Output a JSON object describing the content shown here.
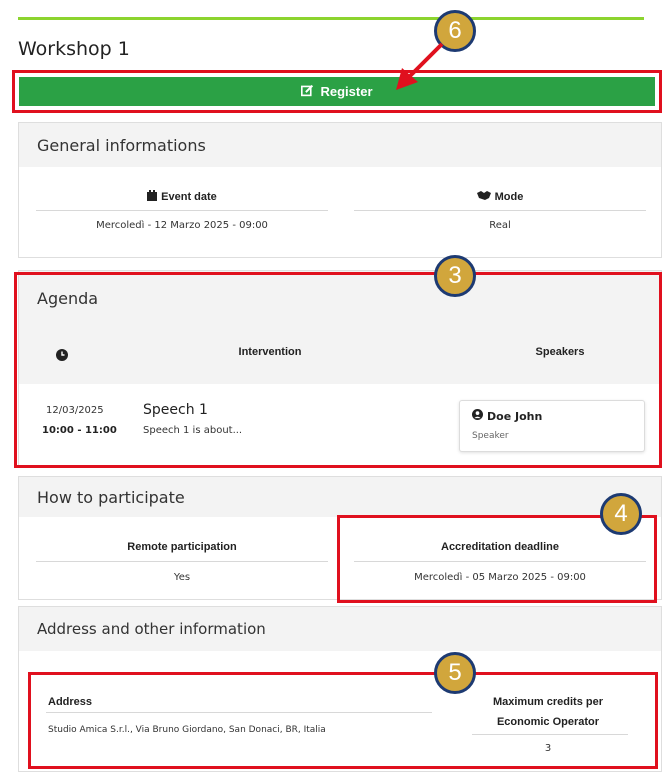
{
  "page_title": "Workshop 1",
  "register_label": "Register",
  "general": {
    "heading": "General informations",
    "event_date_label": "Event date",
    "event_date_value": "Mercoledì - 12 Marzo 2025 - 09:00",
    "mode_label": "Mode",
    "mode_value": "Real"
  },
  "agenda": {
    "heading": "Agenda",
    "col_intervention": "Intervention",
    "col_speakers": "Speakers",
    "rows": [
      {
        "date": "12/03/2025",
        "time": "10:00 - 11:00",
        "title": "Speech 1",
        "description": "Speech 1 is about...",
        "speaker_name": "Doe John",
        "speaker_role": "Speaker"
      }
    ]
  },
  "participate": {
    "heading": "How to participate",
    "remote_label": "Remote participation",
    "remote_value": "Yes",
    "deadline_label": "Accreditation deadline",
    "deadline_value": "Mercoledì - 05 Marzo 2025 - 09:00"
  },
  "address": {
    "heading": "Address and other information",
    "address_label": "Address",
    "address_value": "Studio Amica S.r.l., Via Bruno Giordano, San Donaci, BR, Italia",
    "credits_label_1": "Maximum credits per",
    "credits_label_2": "Economic Operator",
    "credits_value": "3"
  },
  "badges": [
    "6",
    "3",
    "4",
    "5"
  ],
  "colors": {
    "register_green": "#2ba145",
    "highlight_red": "#e0101e",
    "badge_gold": "#d1a63c",
    "badge_border": "#1d3a72",
    "top_line": "#8cd42f"
  },
  "icons": [
    "edit-icon",
    "calendar-icon",
    "handshake-icon",
    "clock-icon",
    "user-circle-icon"
  ]
}
